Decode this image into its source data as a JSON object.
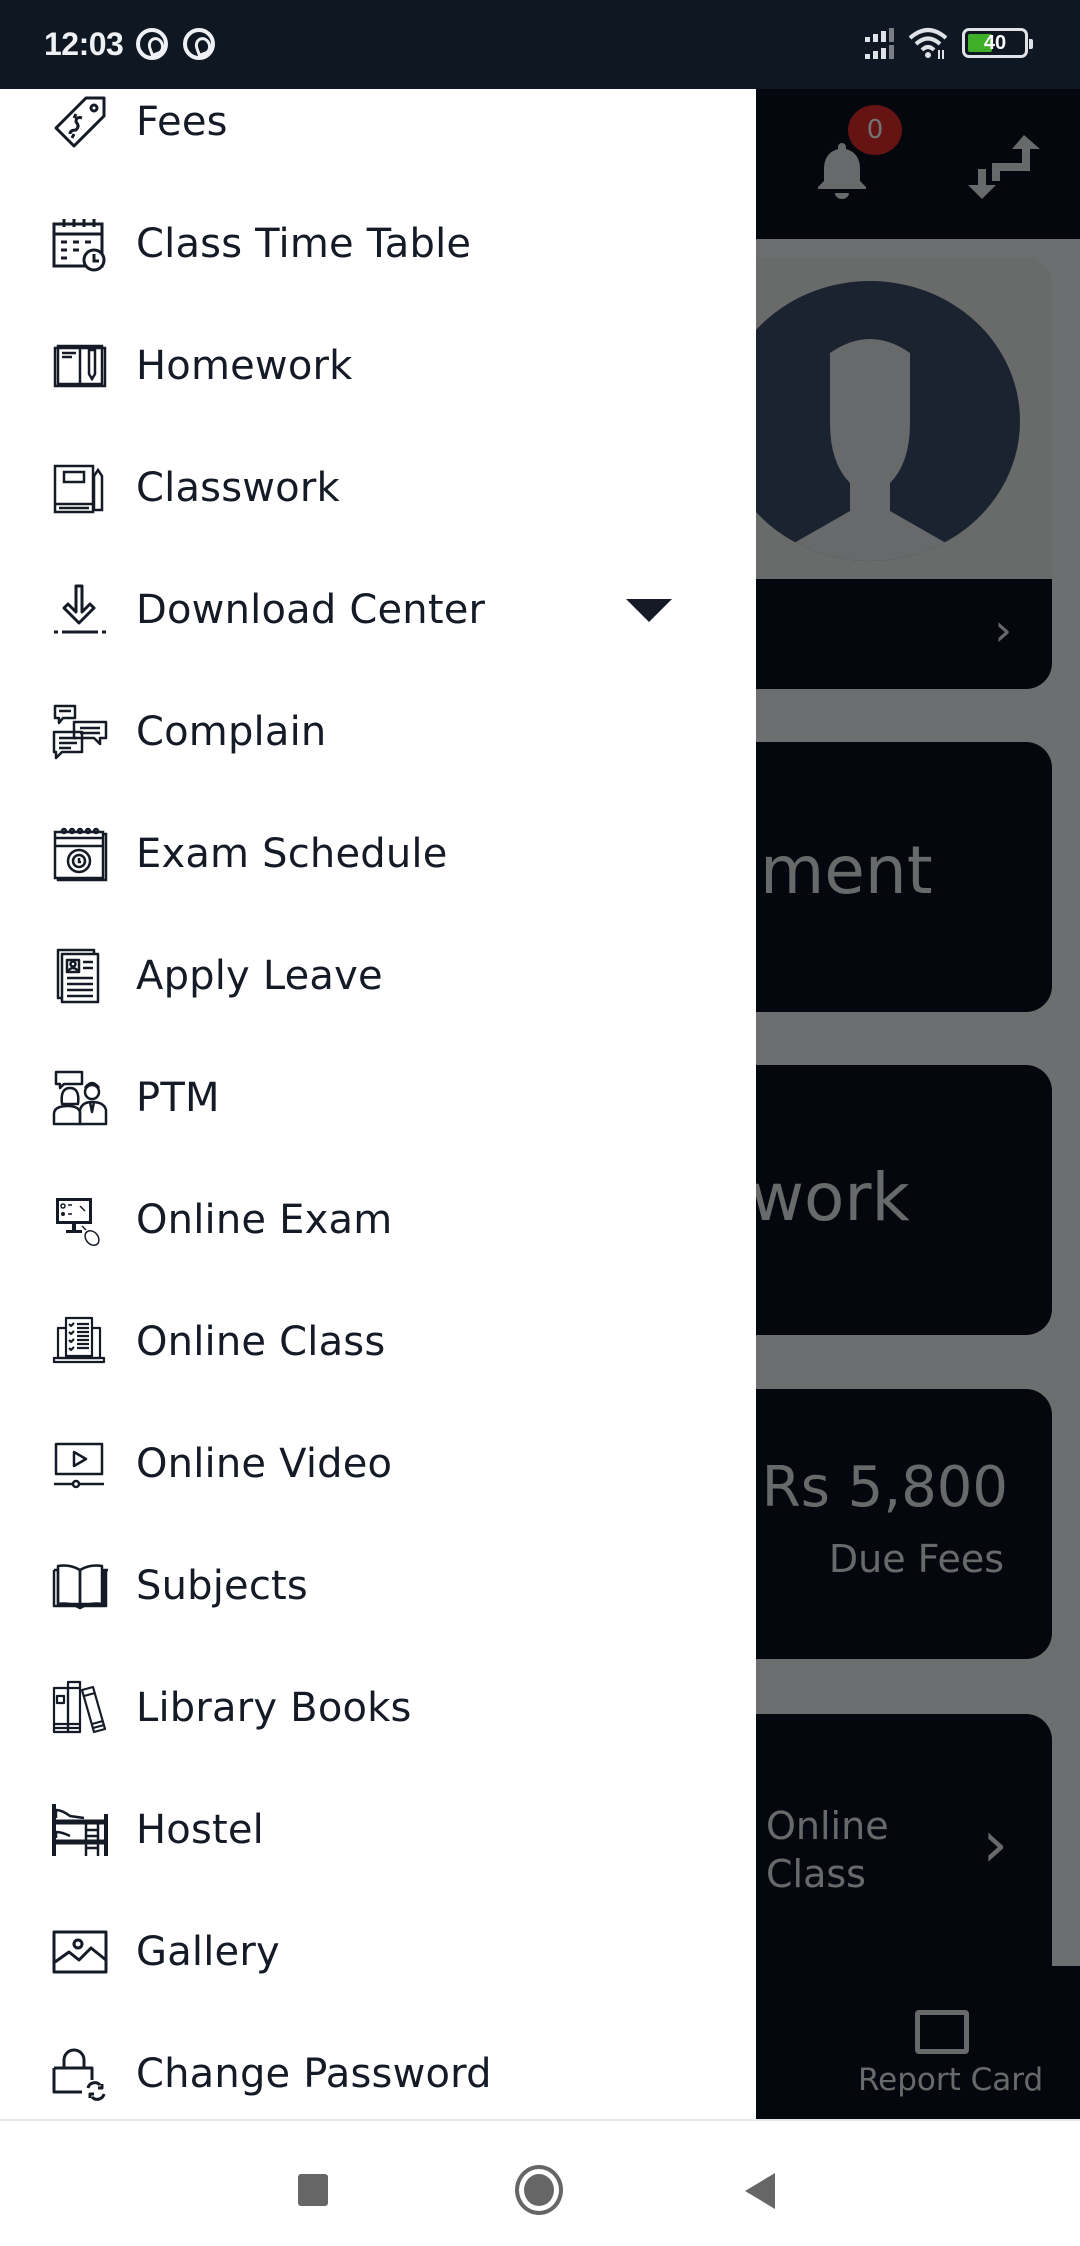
{
  "status_bar": {
    "time": "12:03",
    "battery_level": "40",
    "battery_fraction": 0.4,
    "icons": [
      "q-notification-icon",
      "q-notification-icon",
      "signal-icon",
      "wifi-icon",
      "battery-icon"
    ]
  },
  "background_app": {
    "notification_count": "0",
    "cards": {
      "profile_arrow": "›",
      "card2_title_fragment": "ment",
      "card3_title_fragment": "work",
      "due_fees_amount": "Rs 5,800",
      "due_fees_label": "Due Fees",
      "online_class_label_line1": "Online",
      "online_class_label_line2": "Class",
      "online_class_arrow": "›"
    },
    "bottom_nav": {
      "report_card_label": "Report Card"
    }
  },
  "drawer": {
    "items": [
      {
        "label": "Fees",
        "icon": "price-tag-icon"
      },
      {
        "label": "Class Time Table",
        "icon": "calendar-clock-icon"
      },
      {
        "label": "Homework",
        "icon": "notebook-pencil-icon"
      },
      {
        "label": "Classwork",
        "icon": "book-pencil-icon"
      },
      {
        "label": "Download Center",
        "icon": "download-icon",
        "expandable": true
      },
      {
        "label": "Complain",
        "icon": "chat-bubbles-icon"
      },
      {
        "label": "Exam Schedule",
        "icon": "calendar-timer-icon"
      },
      {
        "label": "Apply Leave",
        "icon": "document-profile-icon"
      },
      {
        "label": "PTM",
        "icon": "parent-teacher-icon"
      },
      {
        "label": "Online Exam",
        "icon": "monitor-quiz-icon"
      },
      {
        "label": "Online Class",
        "icon": "laptop-checklist-icon"
      },
      {
        "label": "Online Video",
        "icon": "video-player-icon"
      },
      {
        "label": "Subjects",
        "icon": "open-book-icon"
      },
      {
        "label": "Library Books",
        "icon": "books-shelf-icon"
      },
      {
        "label": "Hostel",
        "icon": "bunk-bed-icon"
      },
      {
        "label": "Gallery",
        "icon": "image-icon"
      },
      {
        "label": "Change Password",
        "icon": "lock-refresh-icon"
      }
    ]
  },
  "system_nav": {
    "buttons": [
      "recents-button",
      "home-button",
      "back-button"
    ]
  }
}
